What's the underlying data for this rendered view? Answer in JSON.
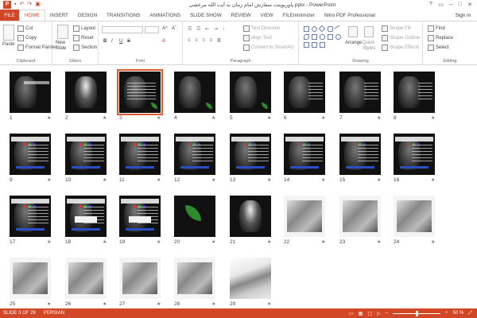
{
  "app": {
    "title": "پاورپوینت سفارش امام زمان به آیت الله مرعشی.pptx - PowerPoint",
    "qat_icons": [
      "save-icon",
      "undo-icon",
      "redo-icon",
      "start-from-beginning-icon"
    ],
    "window_controls": [
      "?",
      "▭",
      "–",
      "□",
      "✕"
    ],
    "sign_in": "Sign in"
  },
  "tabs": [
    "FILE",
    "HOME",
    "INSERT",
    "DESIGN",
    "TRANSITIONS",
    "ANIMATIONS",
    "SLIDE SHOW",
    "REVIEW",
    "VIEW",
    "FILEminimizer",
    "Nitro PDF Professional"
  ],
  "active_tab": "HOME",
  "ribbon": {
    "clipboard": {
      "label": "Clipboard",
      "paste": "Paste",
      "cut": "Cut",
      "copy": "Copy",
      "format_painter": "Format Painter"
    },
    "slides": {
      "label": "Slides",
      "new_slide": "New Slide",
      "layout": "Layout",
      "reset": "Reset",
      "section": "Section"
    },
    "font": {
      "label": "Font",
      "bold": "B",
      "italic": "I",
      "underline": "U",
      "strike": "S",
      "fontcolor": "A"
    },
    "paragraph": {
      "label": "Paragraph",
      "text_direction": "Text Direction",
      "align_text": "Align Text",
      "convert": "Convert to SmartArt"
    },
    "drawing": {
      "label": "Drawing",
      "arrange": "Arrange",
      "quick_styles": "Quick Styles",
      "shape_fill": "Shape Fill",
      "shape_outline": "Shape Outline",
      "shape_effects": "Shape Effects"
    },
    "editing": {
      "label": "Editing",
      "find": "Find",
      "replace": "Replace",
      "select": "Select"
    }
  },
  "slides": [
    {
      "n": "1",
      "type": "title"
    },
    {
      "n": "2",
      "type": "portrait"
    },
    {
      "n": "3",
      "type": "text"
    },
    {
      "n": "4",
      "type": "leaf"
    },
    {
      "n": "5",
      "type": "leaf"
    },
    {
      "n": "6",
      "type": "face"
    },
    {
      "n": "7",
      "type": "face"
    },
    {
      "n": "8",
      "type": "face"
    },
    {
      "n": "9",
      "type": "content"
    },
    {
      "n": "10",
      "type": "content"
    },
    {
      "n": "11",
      "type": "content"
    },
    {
      "n": "12",
      "type": "content"
    },
    {
      "n": "13",
      "type": "content"
    },
    {
      "n": "14",
      "type": "content"
    },
    {
      "n": "15",
      "type": "content"
    },
    {
      "n": "16",
      "type": "content"
    },
    {
      "n": "17",
      "type": "content"
    },
    {
      "n": "18",
      "type": "content"
    },
    {
      "n": "19",
      "type": "content"
    },
    {
      "n": "20",
      "type": "leafbig"
    },
    {
      "n": "21",
      "type": "portrait"
    },
    {
      "n": "22",
      "type": "photo"
    },
    {
      "n": "23",
      "type": "photo"
    },
    {
      "n": "24",
      "type": "photo"
    },
    {
      "n": "25",
      "type": "photo"
    },
    {
      "n": "26",
      "type": "photo"
    },
    {
      "n": "27",
      "type": "photo"
    },
    {
      "n": "28",
      "type": "photo"
    },
    {
      "n": "29",
      "type": "laptop"
    }
  ],
  "selected_slide": "3",
  "status": {
    "slide_info": "SLIDE 3 OF 29",
    "language": "PERSIAN",
    "zoom": "50 %",
    "zoom_level": 0.5
  },
  "colors": {
    "accent": "#d24726",
    "selection": "#e05a30"
  }
}
